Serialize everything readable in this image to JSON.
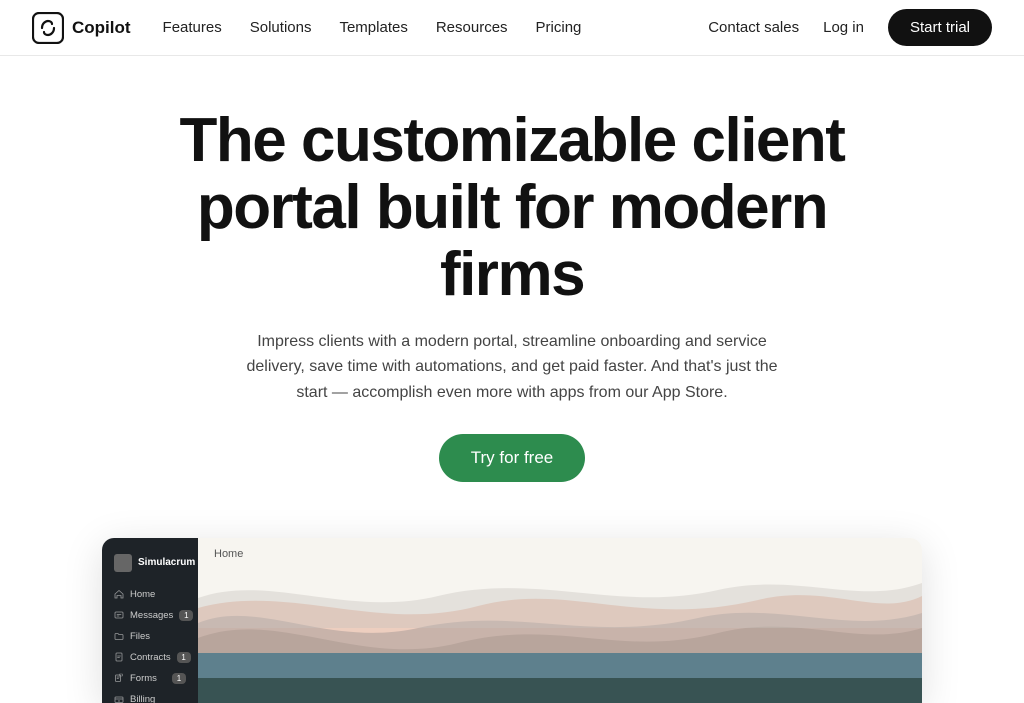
{
  "logo": {
    "text": "Copilot"
  },
  "nav": {
    "links": [
      {
        "label": "Features",
        "id": "features"
      },
      {
        "label": "Solutions",
        "id": "solutions"
      },
      {
        "label": "Templates",
        "id": "templates"
      },
      {
        "label": "Resources",
        "id": "resources"
      },
      {
        "label": "Pricing",
        "id": "pricing"
      }
    ],
    "contact_sales": "Contact sales",
    "log_in": "Log in",
    "start_trial": "Start trial"
  },
  "hero": {
    "headline_line1": "The customizable client",
    "headline_line2": "portal built for modern firms",
    "subtext": "Impress clients with a modern portal, streamline onboarding and service delivery, save time with automations, and get paid faster. And that's just the start — accomplish even more with apps from our App Store.",
    "cta": "Try for free"
  },
  "app_preview": {
    "sidebar_brand": "Simulacrum",
    "home_label": "Home",
    "nav_items": [
      {
        "label": "Home",
        "icon": "home",
        "badge": null
      },
      {
        "label": "Messages",
        "icon": "message",
        "badge": "1"
      },
      {
        "label": "Files",
        "icon": "folder",
        "badge": null
      },
      {
        "label": "Contracts",
        "icon": "contract",
        "badge": "1"
      },
      {
        "label": "Forms",
        "icon": "form",
        "badge": "1"
      },
      {
        "label": "Billing",
        "icon": "billing",
        "badge": null
      }
    ]
  }
}
